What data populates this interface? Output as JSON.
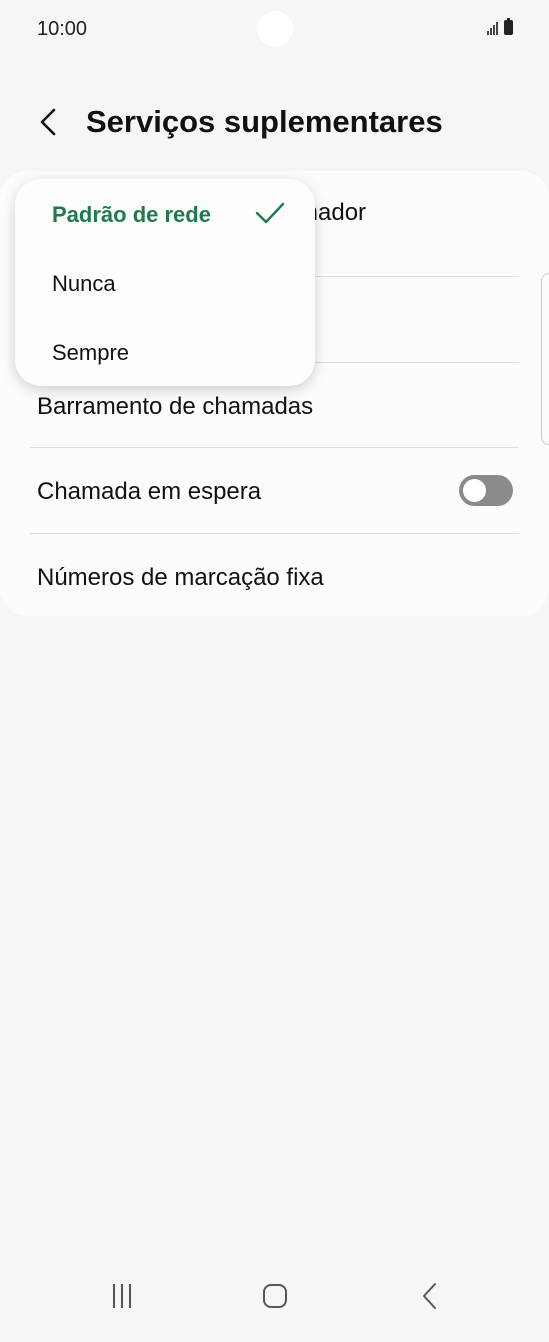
{
  "status_bar": {
    "time": "10:00"
  },
  "header": {
    "title": "Serviços suplementares"
  },
  "settings": {
    "items": [
      {
        "label": "ID do chamador"
      },
      {
        "label": ""
      },
      {
        "label": "Barramento de chamadas"
      },
      {
        "label": "Chamada em espera",
        "toggle": "off"
      },
      {
        "label": "Números de marcação fixa"
      }
    ],
    "visible_first_item_fragment": "mador"
  },
  "dropdown": {
    "options": [
      {
        "label": "Padrão de rede",
        "selected": true
      },
      {
        "label": "Nunca",
        "selected": false
      },
      {
        "label": "Sempre",
        "selected": false
      }
    ]
  },
  "colors": {
    "accent": "#1f7a4c",
    "toggle_off": "#8a8a8e"
  },
  "icons": [
    "back-icon",
    "checkmark-icon",
    "signal-icon",
    "battery-icon",
    "recents-icon",
    "home-icon",
    "nav-back-icon"
  ]
}
